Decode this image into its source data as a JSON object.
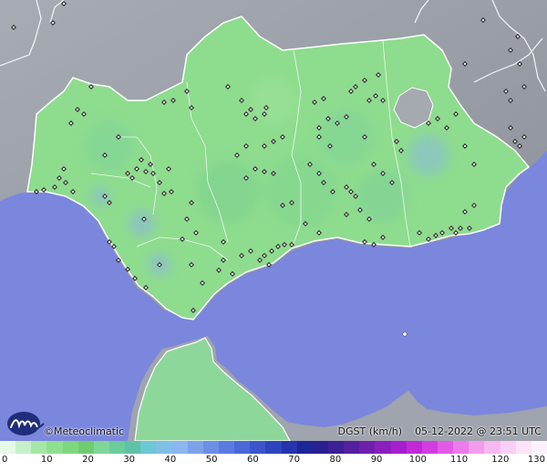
{
  "brand": {
    "name": "Meteoclimatic",
    "copyright_symbol": "©"
  },
  "caption": {
    "variable": "DGST (km/h)",
    "datetime": "05-12-2022 @ 23:51 UTC"
  },
  "legend": {
    "unit": "km/h",
    "ticks": [
      "0",
      "10",
      "20",
      "30",
      "40",
      "50",
      "60",
      "70",
      "80",
      "90",
      "100",
      "110",
      "120",
      "130"
    ],
    "colors": [
      "#e6f8e6",
      "#c8f0c8",
      "#a6e6a6",
      "#8ee08e",
      "#7ed67e",
      "#70cc70",
      "#7fd69a",
      "#6ccc9c",
      "#5ec2a8",
      "#6fc6d6",
      "#7fbfe8",
      "#8db5f0",
      "#7ea2ea",
      "#6c8ee6",
      "#5a7be0",
      "#4a68d8",
      "#3c55cc",
      "#2f43bf",
      "#2533ad",
      "#1d2699",
      "#2a1f90",
      "#3d1f96",
      "#551fa0",
      "#6f1fae",
      "#8a1fbd",
      "#a520cc",
      "#bf2ad6",
      "#d33ce0",
      "#e25ae6",
      "#ec7ceb",
      "#f29cee",
      "#f6b8f1",
      "#f9d0f5",
      "#fbe4f8",
      "#fdf2fb"
    ]
  },
  "map": {
    "sea_color": "#7b86dd",
    "land_color": "#8edc8e",
    "outside_land_color": "#9fa4ae",
    "stations_visible": true
  }
}
